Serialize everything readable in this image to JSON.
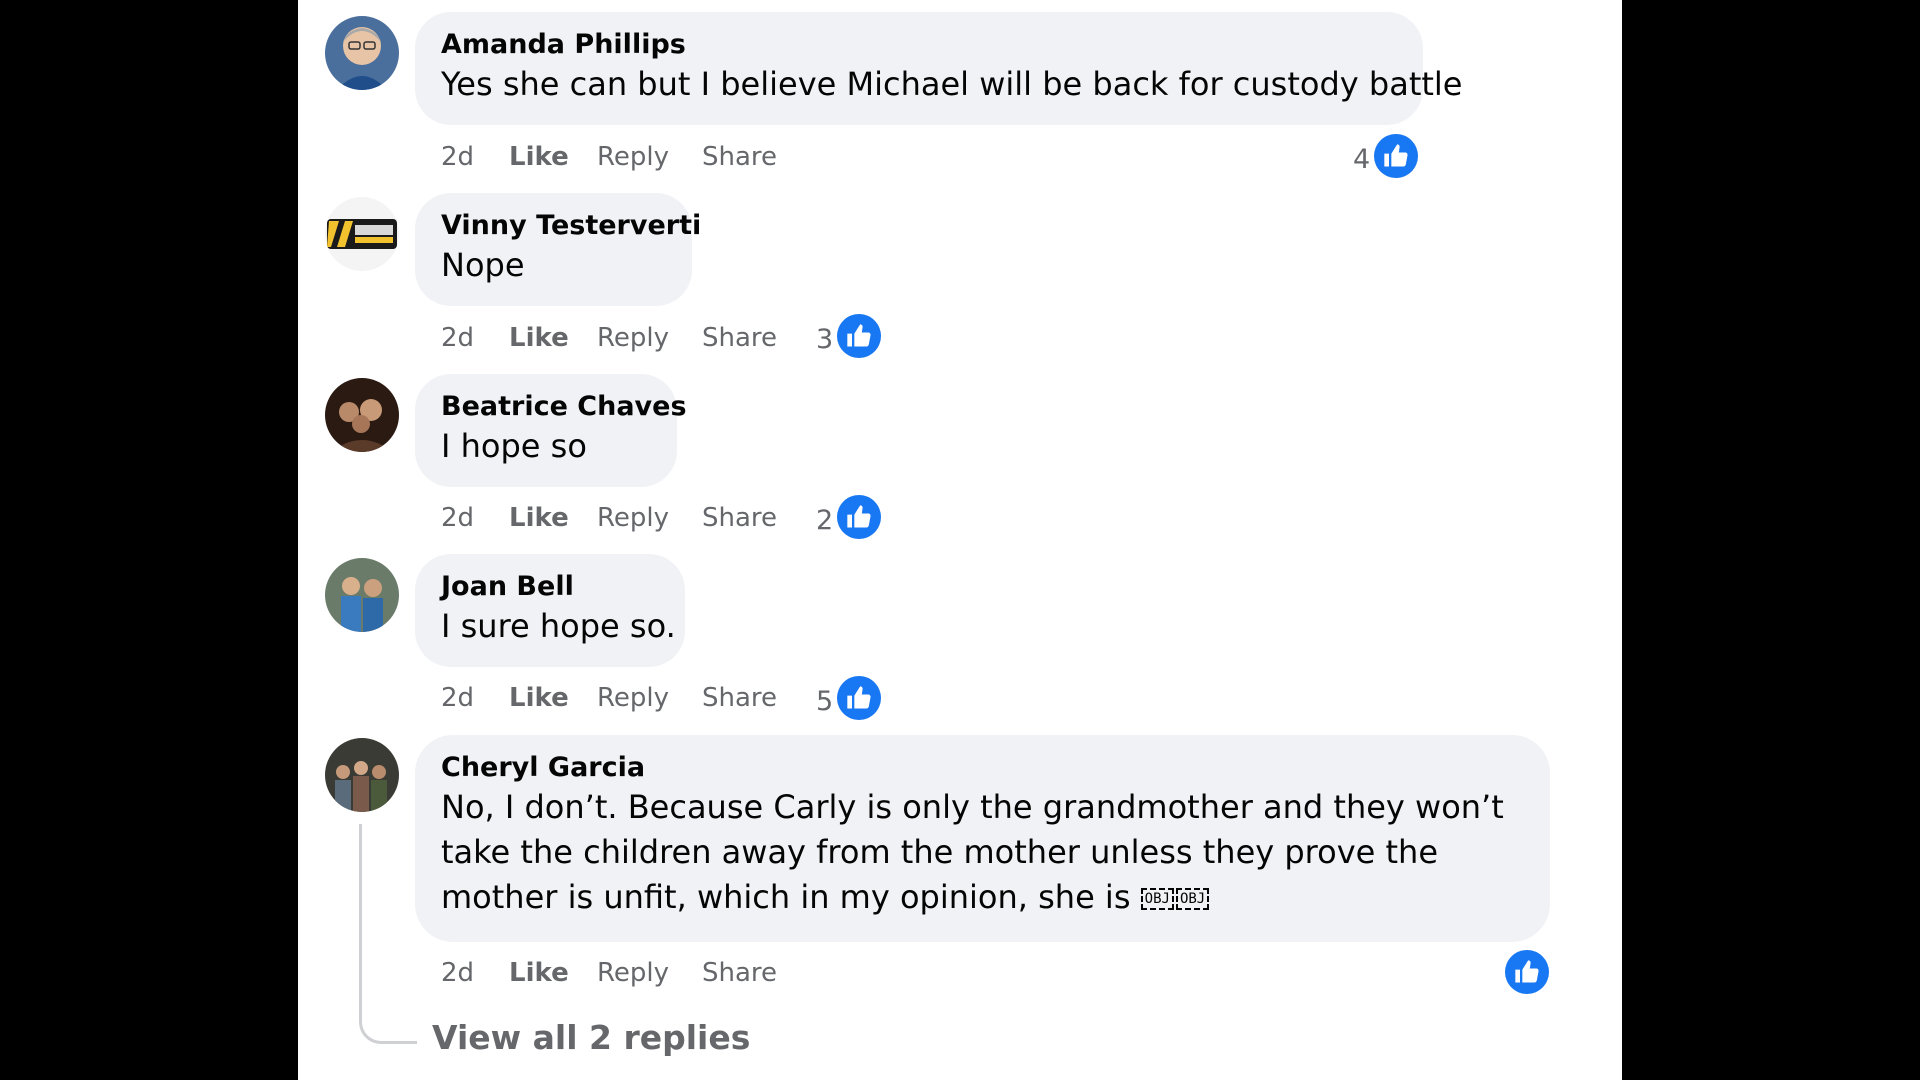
{
  "comments": [
    {
      "author": "Amanda Phillips",
      "text": "Yes she can but I believe Michael will be back for custody battle",
      "time": "2d",
      "like_label": "Like",
      "reply_label": "Reply",
      "share_label": "Share",
      "reaction_count": "4",
      "reaction_icon": "thumbs-up-icon"
    },
    {
      "author": "Vinny Testerverti",
      "text": "Nope",
      "time": "2d",
      "like_label": "Like",
      "reply_label": "Reply",
      "share_label": "Share",
      "reaction_count": "3",
      "reaction_icon": "thumbs-up-icon"
    },
    {
      "author": "Beatrice Chaves",
      "text": "I hope so",
      "time": "2d",
      "like_label": "Like",
      "reply_label": "Reply",
      "share_label": "Share",
      "reaction_count": "2",
      "reaction_icon": "thumbs-up-icon"
    },
    {
      "author": "Joan Bell",
      "text": "I sure hope so.",
      "time": "2d",
      "like_label": "Like",
      "reply_label": "Reply",
      "share_label": "Share",
      "reaction_count": "5",
      "reaction_icon": "thumbs-up-icon"
    },
    {
      "author": "Cheryl Garcia",
      "text": "No, I don’t. Because Carly is only the grandmother and they won’t take the children away from the mother unless they prove the mother is unfit, which in my opinion, she is",
      "emoji_placeholders": [
        "OBJ",
        "OBJ"
      ],
      "time": "2d",
      "like_label": "Like",
      "reply_label": "Reply",
      "share_label": "Share",
      "reaction_icon": "thumbs-up-icon"
    }
  ],
  "view_replies_label": "View all 2 replies",
  "colors": {
    "page_background": "#000000",
    "panel_background": "#ffffff",
    "bubble_background": "#f0f2f5",
    "secondary_text": "#65676b",
    "like_blue": "#1877f2",
    "thread_line": "#ced0d4"
  }
}
